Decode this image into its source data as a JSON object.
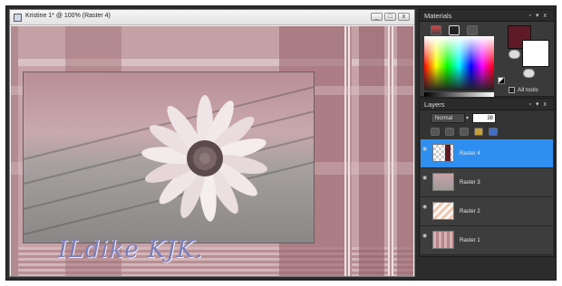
{
  "window": {
    "title": "Kristine 1* @ 100% (Raster 4)",
    "btn_min": "_",
    "btn_max": "□",
    "btn_close": "x"
  },
  "canvas": {
    "signature": "ILdike KJK."
  },
  "materials": {
    "title": "Materials",
    "all_tools_label": "All tools",
    "foreground_color": "#5e1b26",
    "background_color": "#ffffff"
  },
  "layers": {
    "title": "Layers",
    "blend_mode": "Normal",
    "opacity": "38",
    "items": [
      {
        "name": "Raster 4"
      },
      {
        "name": "Raster 3"
      },
      {
        "name": "Raster 2"
      },
      {
        "name": "Raster 1"
      }
    ]
  },
  "colors": {
    "selected_layer": "#2f8ff0",
    "panel_bg": "#3a3a3a"
  }
}
